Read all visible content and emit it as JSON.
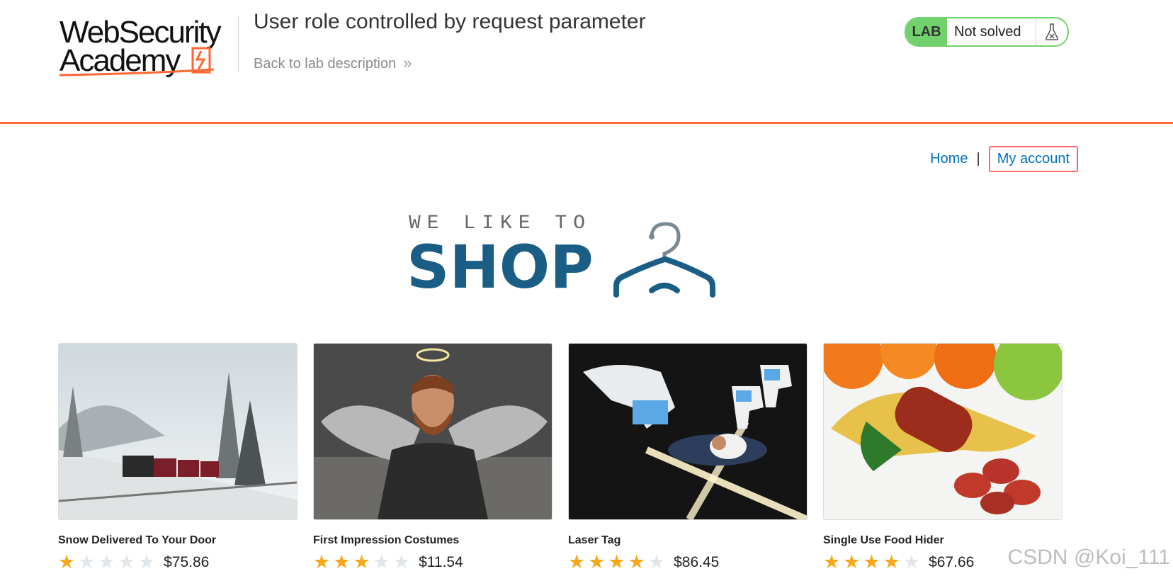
{
  "header": {
    "logo": {
      "line1": "WebSecurity",
      "line2": "Academy"
    },
    "lab_title": "User role controlled by request parameter",
    "back_link": "Back to lab description",
    "badge": {
      "tag": "LAB",
      "status": "Not solved"
    }
  },
  "nav": {
    "home": "Home",
    "separator": "|",
    "my_account": "My account"
  },
  "banner": {
    "tagline": "WE LIKE TO",
    "word": "SHOP"
  },
  "products": [
    {
      "name": "Snow Delivered To Your Door",
      "rating": 1,
      "price": "$75.86"
    },
    {
      "name": "First Impression Costumes",
      "rating": 3,
      "price": "$11.54"
    },
    {
      "name": "Laser Tag",
      "rating": 4,
      "price": "$86.45"
    },
    {
      "name": "Single Use Food Hider",
      "rating": 4,
      "price": "$67.66"
    }
  ],
  "watermark": "CSDN @Koi_111",
  "colors": {
    "accent": "#ff6633",
    "link": "#0071bc",
    "lab_green": "#70d16d",
    "shop_blue": "#1b5e85",
    "star": "#f6a81a"
  },
  "icons": [
    "chevron-right-double-icon",
    "flask-icon",
    "hanger-icon",
    "star-icon"
  ]
}
